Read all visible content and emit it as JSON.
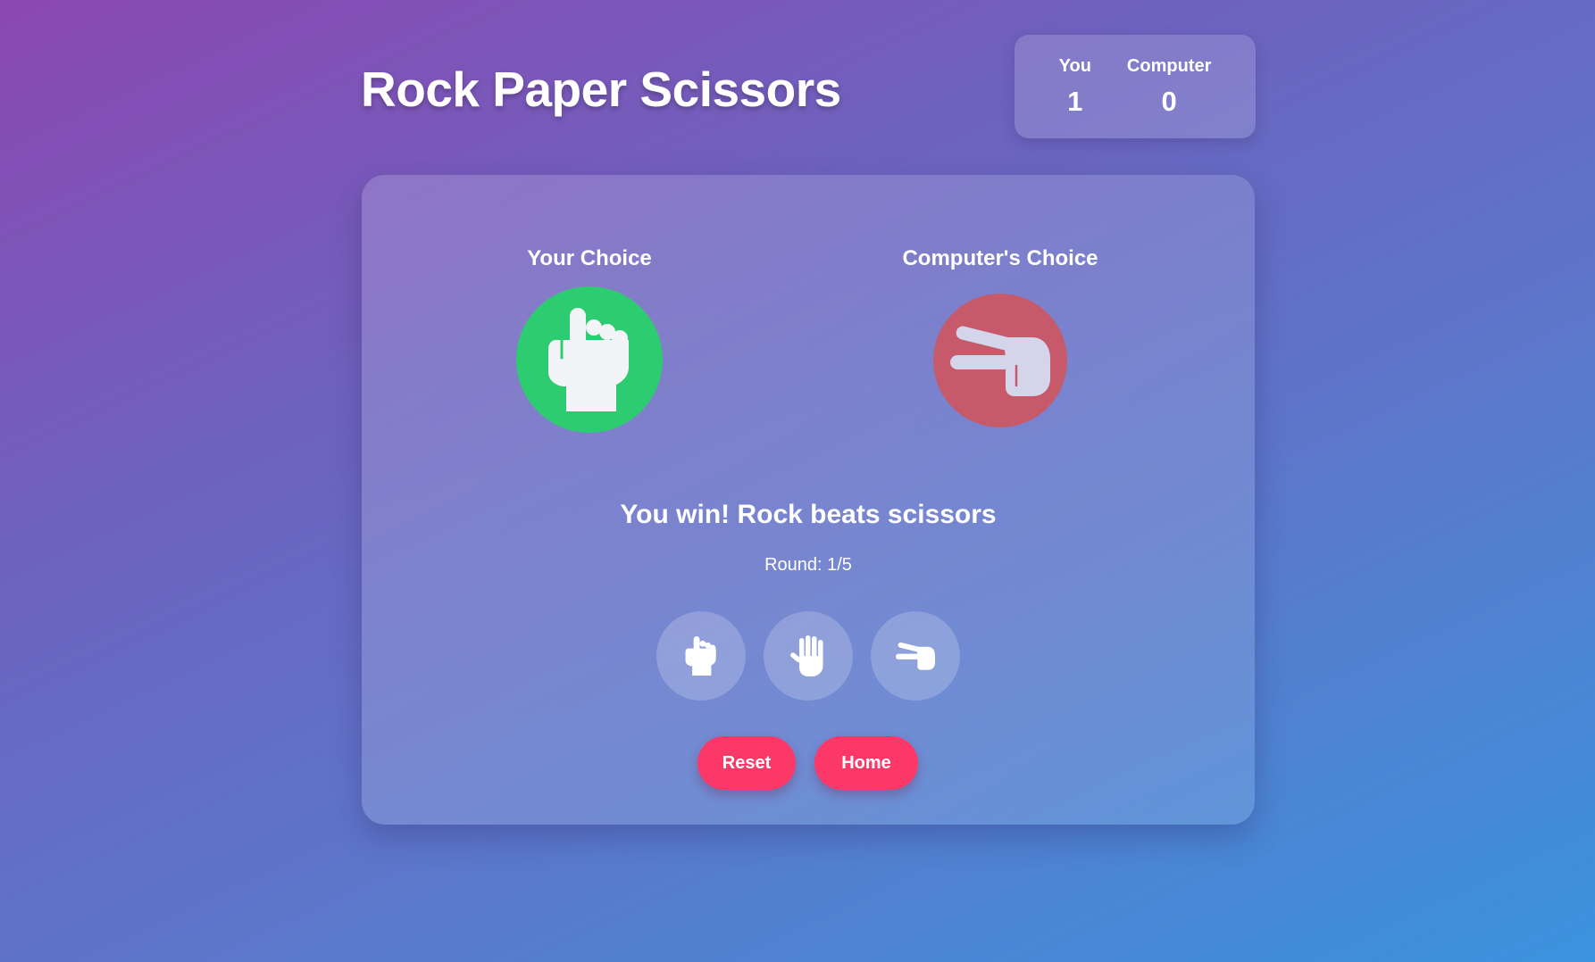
{
  "header": {
    "title": "Rock Paper Scissors"
  },
  "scoreboard": {
    "player_label": "You",
    "player_score": "1",
    "computer_label": "Computer",
    "computer_score": "0"
  },
  "game": {
    "player_choice_label": "Your Choice",
    "player_choice_icon": "rock-icon",
    "computer_choice_label": "Computer's Choice",
    "computer_choice_icon": "scissors-icon",
    "result_text": "You win! Rock beats scissors",
    "round_text": "Round: 1/5",
    "options": [
      {
        "name": "rock",
        "icon": "rock-icon"
      },
      {
        "name": "paper",
        "icon": "paper-icon"
      },
      {
        "name": "scissors",
        "icon": "scissors-icon"
      }
    ]
  },
  "actions": {
    "reset_label": "Reset",
    "home_label": "Home"
  },
  "colors": {
    "win": "#2ecc71",
    "lose": "#c65a6a",
    "button": "#fb3868"
  }
}
